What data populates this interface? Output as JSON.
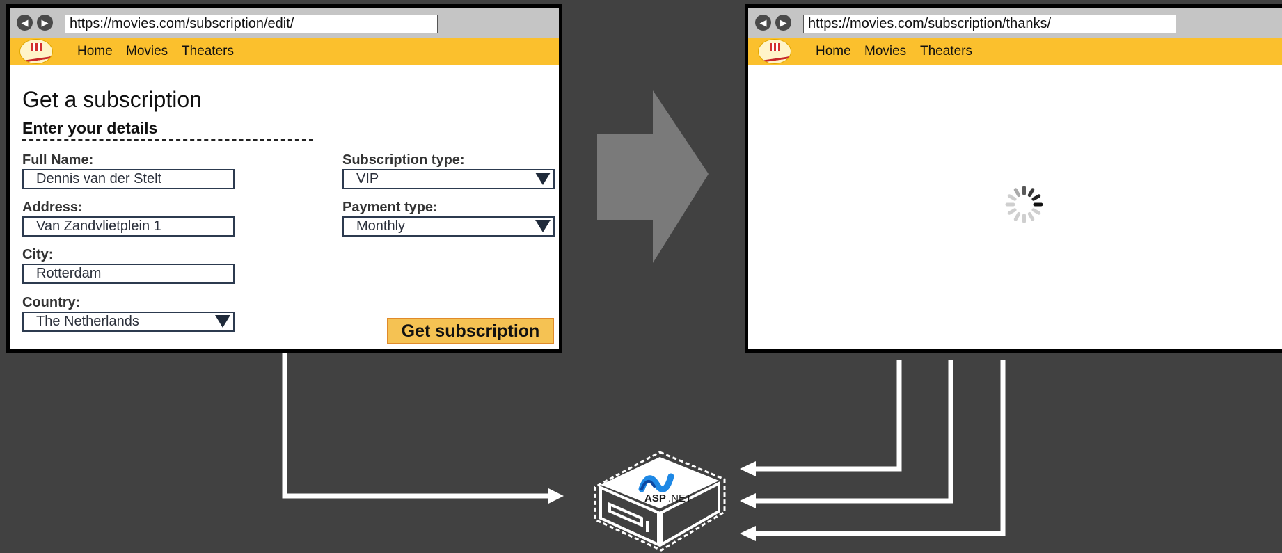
{
  "left_browser": {
    "url": "https://movies.com/subscription/edit/",
    "nav_back": "◀",
    "nav_forward": "▶",
    "menu": [
      "Home",
      "Movies",
      "Theaters"
    ],
    "form": {
      "title": "Get a subscription",
      "subtitle": "Enter your details",
      "full_name_label": "Full Name:",
      "full_name_value": "Dennis van der Stelt",
      "address_label": "Address:",
      "address_value": "Van Zandvlietplein 1",
      "city_label": "City:",
      "city_value": "Rotterdam",
      "country_label": "Country:",
      "country_value": "The Netherlands",
      "subscription_type_label": "Subscription type:",
      "subscription_type_value": "VIP",
      "payment_type_label": "Payment type:",
      "payment_type_value": "Monthly",
      "submit_label": "Get subscription"
    }
  },
  "right_browser": {
    "url": "https://movies.com/subscription/thanks/",
    "nav_back": "◀",
    "nav_forward": "▶",
    "menu": [
      "Home",
      "Movies",
      "Theaters"
    ]
  },
  "server": {
    "logo_text": "ASP",
    "logo_suffix": ".NET"
  },
  "colors": {
    "background": "#414141",
    "menu_bar": "#fbc02d",
    "button": "#f5c253",
    "arrow_gray": "#7a7a7a",
    "connector": "#ffffff"
  }
}
